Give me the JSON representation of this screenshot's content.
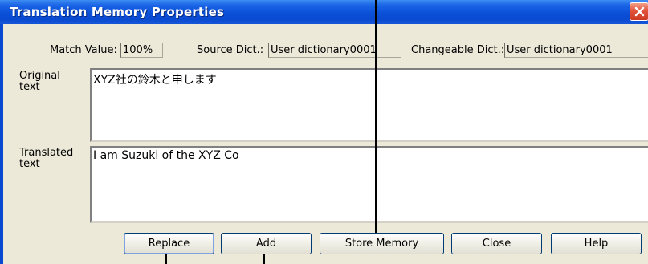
{
  "dialog": {
    "title": "Translation Memory Properties"
  },
  "fields": {
    "match_value_label": "Match Value:",
    "match_value": "100%",
    "source_dict_label": "Source Dict.:",
    "source_dict": "User dictionary0001",
    "changeable_dict_label": "Changeable Dict.:",
    "changeable_dict": "User dictionary0001"
  },
  "original": {
    "label_line1": "Original",
    "label_line2": "text",
    "value": "XYZ社の鈴木と申します"
  },
  "translated": {
    "label_line1": "Translated",
    "label_line2": "text",
    "value": "I am Suzuki of the XYZ Co"
  },
  "buttons": {
    "replace": "Replace",
    "add": "Add",
    "store_memory": "Store Memory",
    "close": "Close",
    "help": "Help"
  },
  "icons": {
    "close": "close-icon"
  },
  "colors": {
    "titlebar": "#0a4ad0",
    "dialog_bg": "#ece9d8",
    "close_button": "#e2533a"
  }
}
